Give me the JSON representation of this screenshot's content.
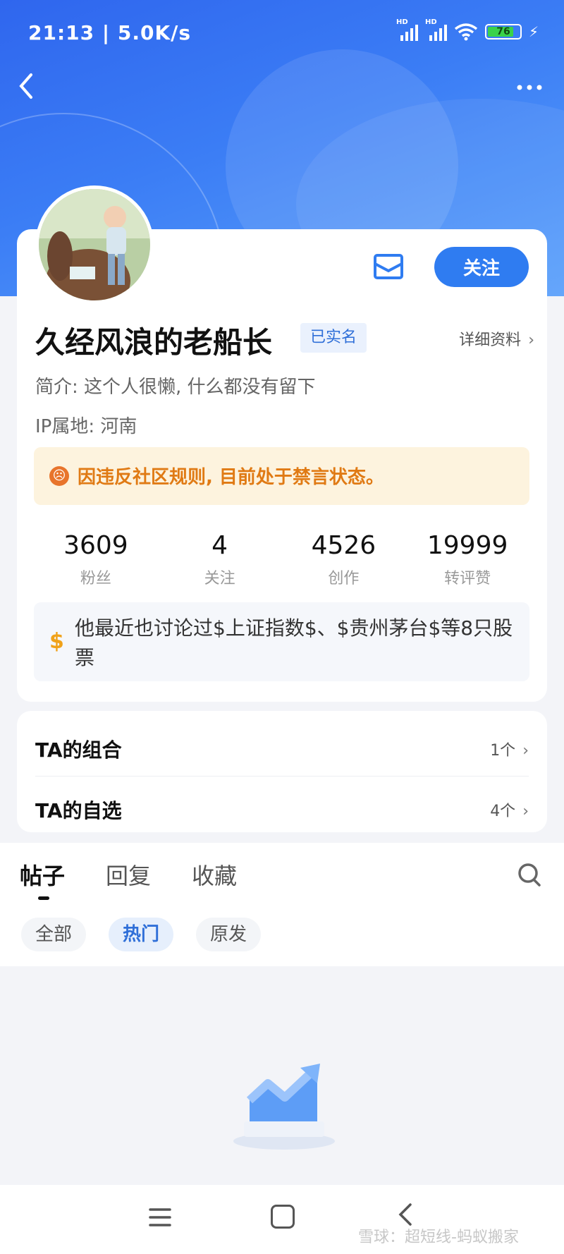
{
  "status": {
    "time": "21:13 | 5.0K/s",
    "battery": "76",
    "hd": "HD"
  },
  "profile": {
    "name": "久经风浪的老船长",
    "verified_badge": "已实名",
    "detail_link": "详细资料",
    "bio": "简介: 这个人很懒, 什么都没有留下",
    "ip": "IP属地: 河南",
    "follow_label": "关注",
    "ban_notice": "因违反社区规则, 目前处于禁言状态。",
    "stats": [
      {
        "value": "3609",
        "label": "粉丝"
      },
      {
        "value": "4",
        "label": "关注"
      },
      {
        "value": "4526",
        "label": "创作"
      },
      {
        "value": "19999",
        "label": "转评赞"
      }
    ],
    "stocks_text": "他最近也讨论过$上证指数$、$贵州茅台$等8只股票",
    "dollar_symbol": "$"
  },
  "lists": [
    {
      "title": "TA的组合",
      "count": "1个"
    },
    {
      "title": "TA的自选",
      "count": "4个"
    }
  ],
  "tabs": [
    "帖子",
    "回复",
    "收藏"
  ],
  "filters": [
    "全部",
    "热门",
    "原发"
  ],
  "watermark": "雪球：超短线-蚂蚁搬家",
  "colors": {
    "accent": "#2f7cf1",
    "ban": "#e07a14",
    "hero": "#3b7df5"
  }
}
